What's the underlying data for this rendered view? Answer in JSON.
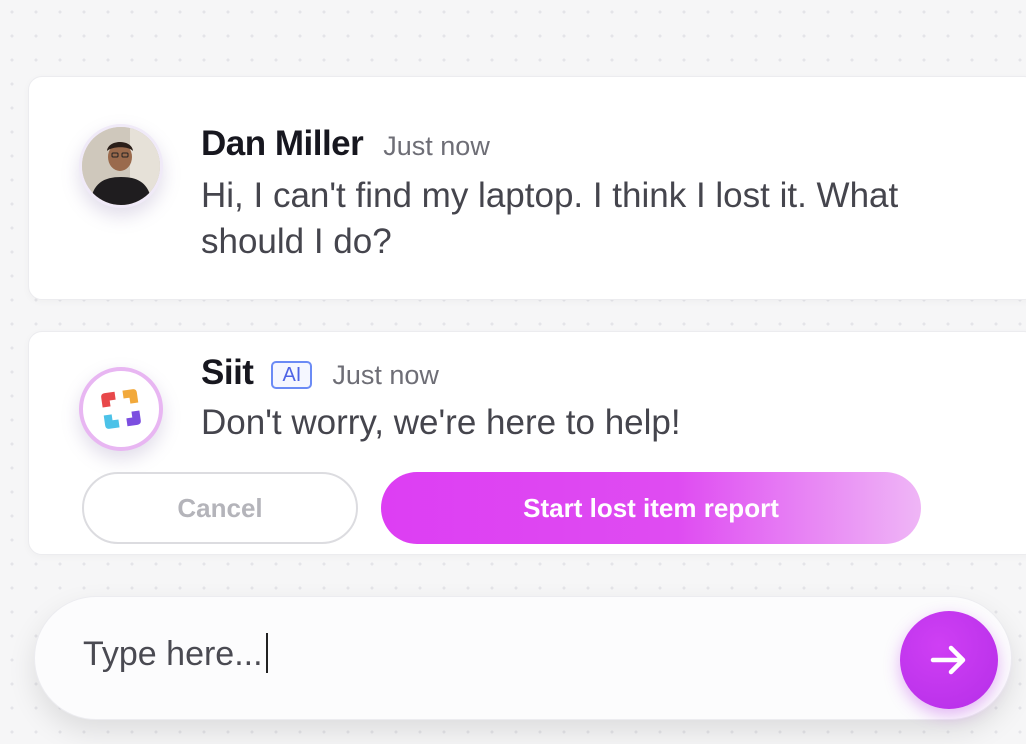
{
  "messages": [
    {
      "sender": "Dan Miller",
      "time": "Just now",
      "text": "Hi, I can't find my laptop. I think I lost it. What should I do?"
    },
    {
      "sender": "Siit",
      "badge": "AI",
      "time": "Just now",
      "text": "Don't worry, we're here to help!",
      "actions": {
        "cancel_label": "Cancel",
        "primary_label": "Start lost item report"
      }
    }
  ],
  "composer": {
    "value": "Type here...",
    "send_icon": "arrow-right-icon"
  },
  "colors": {
    "accent": "#d63ff3",
    "ai_badge": "#5b73f0",
    "logo": [
      "#e8484a",
      "#f2a93b",
      "#4cc2e8",
      "#7c4ee0"
    ]
  }
}
